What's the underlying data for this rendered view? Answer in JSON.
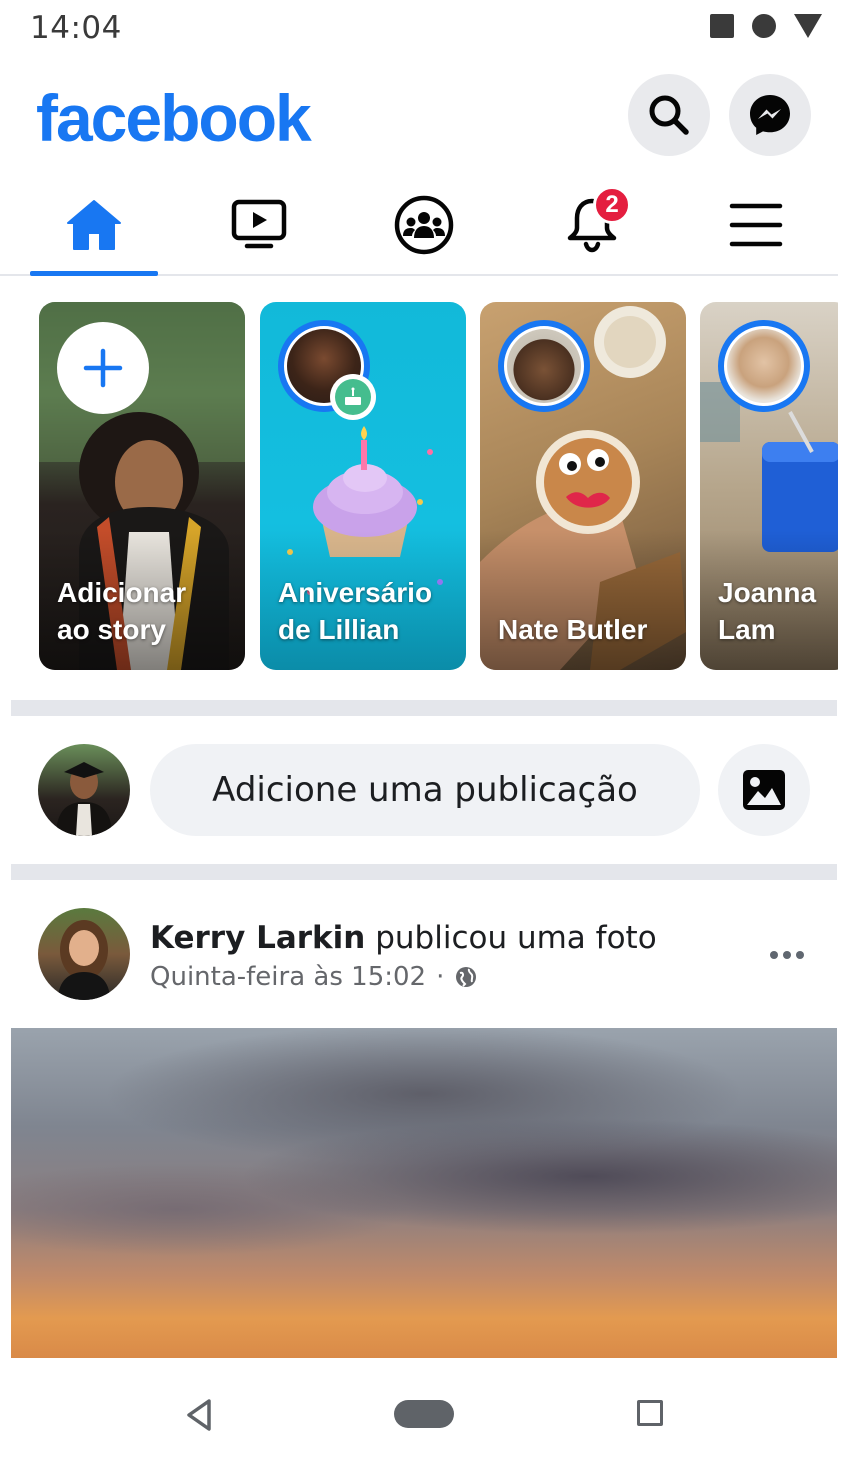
{
  "status_bar": {
    "time": "14:04",
    "icons": [
      "stop-square-icon",
      "circle-icon",
      "signal-triangle-icon"
    ]
  },
  "header": {
    "logo": "facebook",
    "buttons": [
      "search-icon",
      "messenger-icon"
    ],
    "brand_color": "#1877f2"
  },
  "nav_tabs": {
    "items": [
      {
        "name": "home",
        "icon": "home-icon",
        "active": true
      },
      {
        "name": "watch",
        "icon": "video-icon",
        "active": false
      },
      {
        "name": "groups",
        "icon": "groups-icon",
        "active": false
      },
      {
        "name": "notifications",
        "icon": "bell-icon",
        "active": false,
        "badge": "2"
      },
      {
        "name": "menu",
        "icon": "hamburger-icon",
        "active": false
      }
    ]
  },
  "stories": [
    {
      "label": "Adicionar\nao story",
      "type": "add"
    },
    {
      "label": "Aniversário\nde Lillian",
      "type": "birthday"
    },
    {
      "label": "Nate Butler",
      "type": "story"
    },
    {
      "label": "Joanna\nLam",
      "type": "story"
    }
  ],
  "composer": {
    "placeholder": "Adicione uma publicação",
    "photo_icon": "photo-icon"
  },
  "post": {
    "author": "Kerry Larkin",
    "action": "publicou uma foto",
    "timestamp": "Quinta-feira às 15:02",
    "separator": "·",
    "privacy_icon": "globe-icon",
    "more_icon": "more-dots-icon"
  },
  "system_nav": [
    "back-icon",
    "home-pill-icon",
    "recents-icon"
  ],
  "colors": {
    "accent": "#1877f2",
    "badge": "#e41e3f",
    "birthday_story": "#14bfe0",
    "birthday_badge": "#45bd8e"
  }
}
